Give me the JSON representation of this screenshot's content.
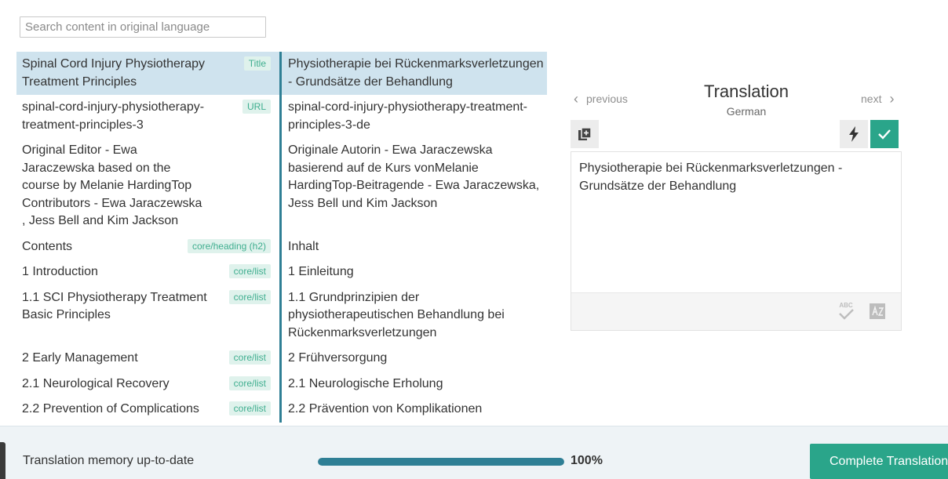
{
  "search": {
    "placeholder": "Search content in original language"
  },
  "segments": [
    {
      "source": "Spinal Cord Injury Physiotherapy Treatment Principles",
      "tag": "Title",
      "target": "Physiotherapie bei Rückenmarksverletzungen - Grundsätze der Behandlung",
      "selected": true
    },
    {
      "source": "spinal-cord-injury-physiotherapy-treatment-principles-3",
      "tag": "URL",
      "target": "spinal-cord-injury-physiotherapy-treatment-principles-3-de",
      "selected": false
    },
    {
      "source": "Original Editor - Ewa Jaraczewska based on the course by Melanie HardingTop Contributors - Ewa Jaraczewska , Jess Bell and Kim Jackson",
      "tag": "",
      "target": "Originale Autorin - Ewa Jaraczewska basierend auf de Kurs vonMelanie HardingTop-Beitragende - Ewa Jaraczewska, Jess Bell und Kim Jackson",
      "selected": false
    },
    {
      "source": "Contents",
      "tag": "core/heading (h2)",
      "target": "Inhalt",
      "selected": false
    },
    {
      "source": "1 Introduction",
      "tag": "core/list",
      "target": "1 Einleitung",
      "selected": false
    },
    {
      "source": "1.1 SCI Physiotherapy Treatment Basic Principles",
      "tag": "core/list",
      "target": "1.1 Grundprinzipien der physiotherapeutischen Behandlung bei Rückenmarksverletzungen",
      "selected": false
    },
    {
      "source": "2 Early Management",
      "tag": "core/list",
      "target": "2 Frühversorgung",
      "selected": false
    },
    {
      "source": "2.1 Neurological Recovery",
      "tag": "core/list",
      "target": "2.1 Neurologische Erholung",
      "selected": false
    },
    {
      "source": "2.2 Prevention of Complications",
      "tag": "core/list",
      "target": "2.2 Prävention von Komplikationen",
      "selected": false
    }
  ],
  "panel": {
    "previous": "previous",
    "next": "next",
    "title": "Translation",
    "language": "German",
    "editor_value": "Physiotherapie bei Rückenmarksverletzungen - Grundsätze der Behandlung",
    "spell_label": "ABC"
  },
  "bottom": {
    "tm_status": "Translation memory up-to-date",
    "progress": 100,
    "progress_label": "100%",
    "complete_label": "Complete Translation"
  },
  "colors": {
    "accent": "#2aa58a",
    "progress": "#2f7f95",
    "selected_row": "#cfe3ee",
    "tag_bg": "#dff2ec",
    "tag_text": "#3fae8f"
  },
  "icons": {
    "copy": "copy-source-icon",
    "bolt": "lightning-icon",
    "confirm": "checkmark-icon",
    "spell": "spellcheck-icon",
    "az": "sort-az-icon",
    "prev": "chevron-left-icon",
    "next": "chevron-right-icon"
  }
}
